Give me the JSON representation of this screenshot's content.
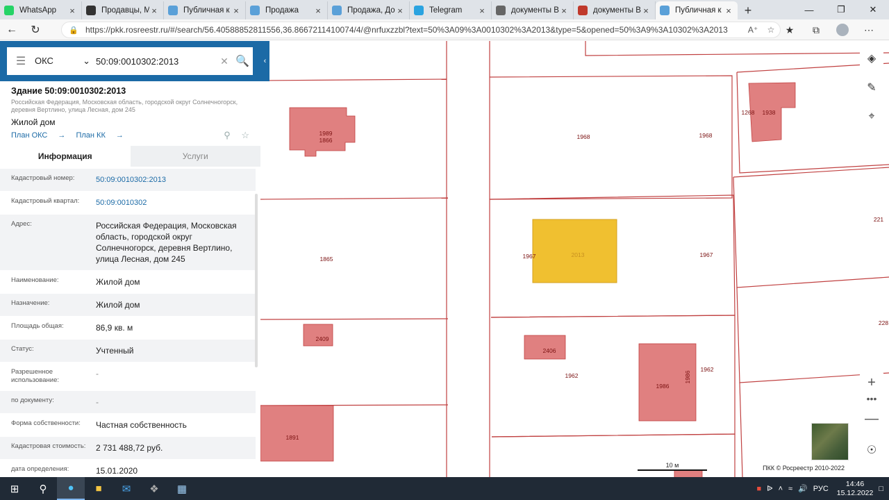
{
  "tabs": [
    {
      "label": "WhatsApp",
      "icon": "whatsapp-icon",
      "color": "#25d366"
    },
    {
      "label": "Продавцы, М",
      "icon": "page-icon",
      "color": "#333333"
    },
    {
      "label": "Публичная к",
      "icon": "pkk-icon",
      "color": "#5aa0d8"
    },
    {
      "label": "Продажа",
      "icon": "pkk-icon",
      "color": "#5aa0d8"
    },
    {
      "label": "Продажа, До",
      "icon": "pkk-icon",
      "color": "#5aa0d8"
    },
    {
      "label": "Telegram",
      "icon": "telegram-icon",
      "color": "#2aa3e0"
    },
    {
      "label": "документы Ве",
      "icon": "doc-icon",
      "color": "#666666"
    },
    {
      "label": "документы Ве",
      "icon": "pdf-icon",
      "color": "#c0392b"
    },
    {
      "label": "Публичная к",
      "icon": "pkk-icon",
      "color": "#5aa0d8"
    }
  ],
  "browser": {
    "url": "https://pkk.rosreestr.ru/#/search/56.40588852811556,36.8667211410074/4/@nrfuxzzbl?text=50%3A09%3A0010302%3A2013&type=5&opened=50%3A9%3A10302%3A2013"
  },
  "search": {
    "type_label": "ОКС",
    "query": "50:09:0010302:2013"
  },
  "object": {
    "title": "Здание 50:09:0010302:2013",
    "address": "Российская Федерация, Московская область, городской округ Солнечногорск, деревня Вертлино, улица Лесная, дом 245",
    "type": "Жилой дом",
    "link_oks": "План ОКС",
    "link_kk": "План КК"
  },
  "info_tabs": {
    "info": "Информация",
    "services": "Услуги"
  },
  "rows": [
    {
      "key": "Кадастровый номер:",
      "value": "50:09:0010302:2013",
      "style": "link"
    },
    {
      "key": "Кадастровый квартал:",
      "value": "50:09:0010302",
      "style": "link"
    },
    {
      "key": "Адрес:",
      "value": "Российская Федерация, Московская область, городской округ Солнечногорск, деревня Вертлино, улица Лесная, дом 245",
      "style": "text"
    },
    {
      "key": "Наименование:",
      "value": "Жилой дом",
      "style": "text"
    },
    {
      "key": "Назначение:",
      "value": "Жилой дом",
      "style": "text"
    },
    {
      "key": "Площадь общая:",
      "value": "86,9 кв. м",
      "style": "text"
    },
    {
      "key": "Статус:",
      "value": "Учтенный",
      "style": "text"
    },
    {
      "key": "Разрешенное использование:",
      "value": "-",
      "style": "dash"
    },
    {
      "key": "по документу:",
      "value": "-",
      "style": "dash"
    },
    {
      "key": "Форма собственности:",
      "value": "Частная собственность",
      "style": "text"
    },
    {
      "key": "Кадастровая стоимость:",
      "value": "2 731 488,72 руб.",
      "style": "text"
    },
    {
      "key": "дата определения:",
      "value": "15.01.2020",
      "style": "text"
    },
    {
      "key": "дата утверждения:",
      "value": "-",
      "style": "dash"
    }
  ],
  "map": {
    "parcel_labels": [
      "1865",
      "1968",
      "1968",
      "1967",
      "1967",
      "1962",
      "1962",
      "221",
      "228"
    ],
    "building_labels": [
      "1989",
      "1866",
      "1268",
      "1938",
      "2013",
      "2409",
      "2406",
      "1986",
      "1986",
      "1891"
    ],
    "scale": "10 м",
    "copyright": "ПКК © Росреестр 2010-2022",
    "colors": {
      "parcel_line": "#c04040",
      "building": "#e08080",
      "selected": "#f0c030"
    }
  },
  "taskbar": {
    "lang": "РУС",
    "time": "14:46",
    "date": "15.12.2022"
  }
}
